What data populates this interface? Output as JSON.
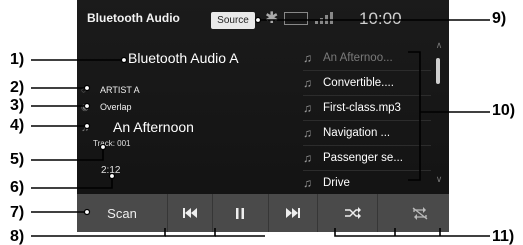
{
  "callouts": {
    "c1": "1)",
    "c2": "2)",
    "c3": "3)",
    "c4": "4)",
    "c5": "5)",
    "c6": "6)",
    "c7": "7)",
    "c8": "8)",
    "c9": "9)",
    "c10": "10)",
    "c11": "11)"
  },
  "header": {
    "title": "Bluetooth Audio",
    "source_label": "Source",
    "clock": "10:00",
    "icons": [
      "bluetooth-icon",
      "battery-icon",
      "signal-icon"
    ]
  },
  "now_playing": {
    "device": "Bluetooth Audio A",
    "artist": "ARTIST A",
    "album": "Overlap",
    "song": "An Afternoon",
    "track": "Track: 001",
    "time": "2:12"
  },
  "playlist": {
    "items": [
      {
        "label": "An Afternoo...",
        "active": false
      },
      {
        "label": "Convertible....",
        "active": true
      },
      {
        "label": "First-class.mp3",
        "active": true
      },
      {
        "label": "Navigation ...",
        "active": true
      },
      {
        "label": "Passenger se...",
        "active": true
      },
      {
        "label": "Drive",
        "active": true
      }
    ]
  },
  "controls": {
    "scan_label": "Scan",
    "prev": "prev-track-icon",
    "pause": "pause-icon",
    "next": "next-track-icon",
    "shuffle": "shuffle-icon",
    "repeat": "repeat-off-icon"
  }
}
